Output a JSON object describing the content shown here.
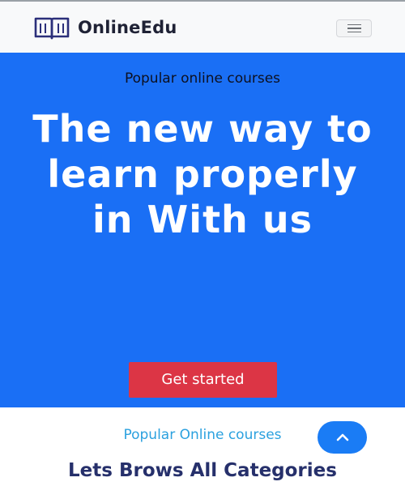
{
  "navbar": {
    "brand_icon": "open-book-icon",
    "brand_name": "OnlineEdu",
    "menu_icon": "hamburger-menu-icon"
  },
  "hero": {
    "subtitle": "Popular online courses",
    "title": "The new way to learn properly in With us",
    "cta_label": "Get started",
    "background_color": "#1a6ff5",
    "cta_color": "#dc3545"
  },
  "section": {
    "subtitle": "Popular Online courses",
    "title": "Lets Brows All Categories"
  },
  "scroll_top": {
    "icon": "chevron-up-icon",
    "color": "#1a7cf5"
  }
}
